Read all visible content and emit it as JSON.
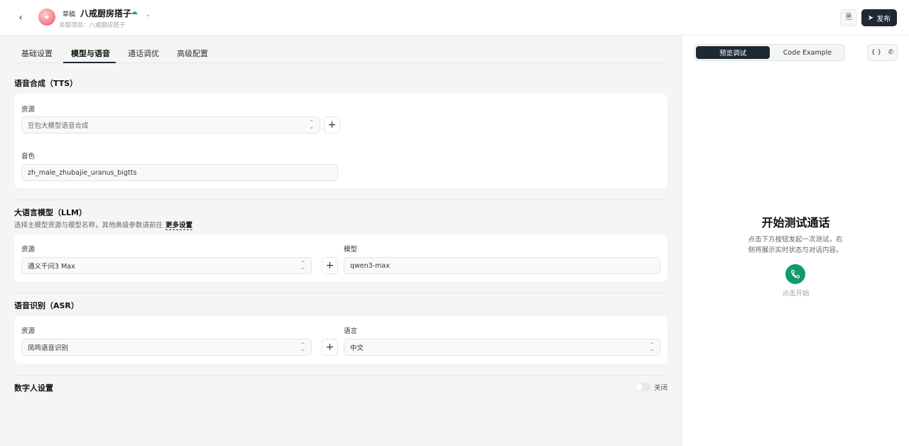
{
  "header": {
    "draft_tag": "草稿",
    "agent_name": "八戒厨房搭子",
    "related_project": "关联项目：八戒厨房搭子",
    "publish_label": "发布"
  },
  "tabs": [
    {
      "label": "基础设置"
    },
    {
      "label": "模型与语音"
    },
    {
      "label": "通话调优"
    },
    {
      "label": "高级配置"
    }
  ],
  "tts": {
    "title": "语音合成（TTS）",
    "resource_label": "资源",
    "resource_value": "豆包大模型语音合成",
    "voice_label": "音色",
    "voice_value": "zh_male_zhubajie_uranus_bigtts"
  },
  "llm": {
    "title": "大语言模型（LLM）",
    "subtitle": "选择主模型资源与模型名称，其他高级参数请前往",
    "more_link": "更多设置",
    "resource_label": "资源",
    "resource_value": "通义千问3 Max",
    "model_label": "模型",
    "model_value": "qwen3-max"
  },
  "asr": {
    "title": "语音识别（ASR）",
    "resource_label": "资源",
    "resource_value": "凤鸣语音识别",
    "language_label": "语言",
    "language_value": "中文"
  },
  "digital_human": {
    "title": "数字人设置",
    "toggle_label": "关闭",
    "enabled": false
  },
  "preview": {
    "tab_active": "预览调试",
    "tab_other": "Code Example",
    "title": "开始测试通话",
    "description": "点击下方按钮发起一次测试，右侧将展示实时状态与对话内容。",
    "call_label": "点击开始"
  }
}
